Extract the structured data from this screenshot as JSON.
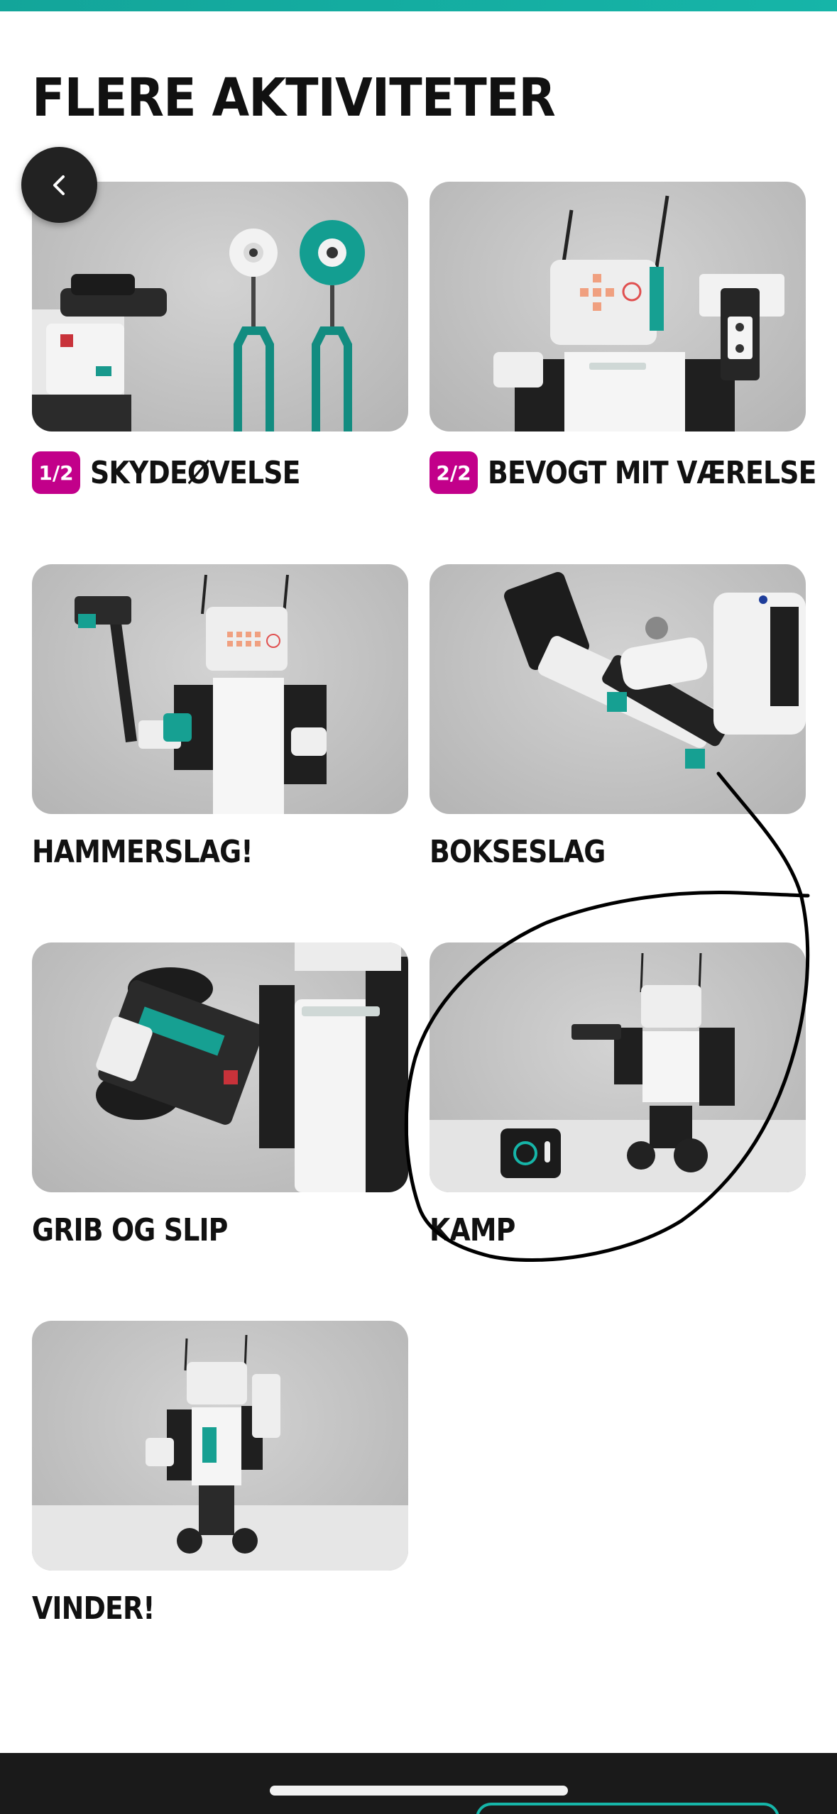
{
  "header": {
    "title": "FLERE AKTIVITETER",
    "back_icon": "chevron-left-icon"
  },
  "colors": {
    "accent": "#16b5a8",
    "badge": "#c2008a",
    "text": "#111111"
  },
  "activities": [
    {
      "label": "SKYDEØVELSE",
      "badge": "1/2",
      "image": "shooting-practice-photo"
    },
    {
      "label": "BEVOGT MIT VÆRELSE",
      "badge": "2/2",
      "image": "guard-my-room-photo"
    },
    {
      "label": "HAMMERSLAG!",
      "badge": "",
      "image": "hammer-strike-photo"
    },
    {
      "label": "BOKSESLAG",
      "badge": "",
      "image": "boxing-punch-photo"
    },
    {
      "label": "GRIB OG SLIP",
      "badge": "",
      "image": "grab-and-release-photo"
    },
    {
      "label": "KAMP",
      "badge": "",
      "image": "fight-photo"
    },
    {
      "label": "VINDER!",
      "badge": "",
      "image": "winner-photo"
    }
  ]
}
